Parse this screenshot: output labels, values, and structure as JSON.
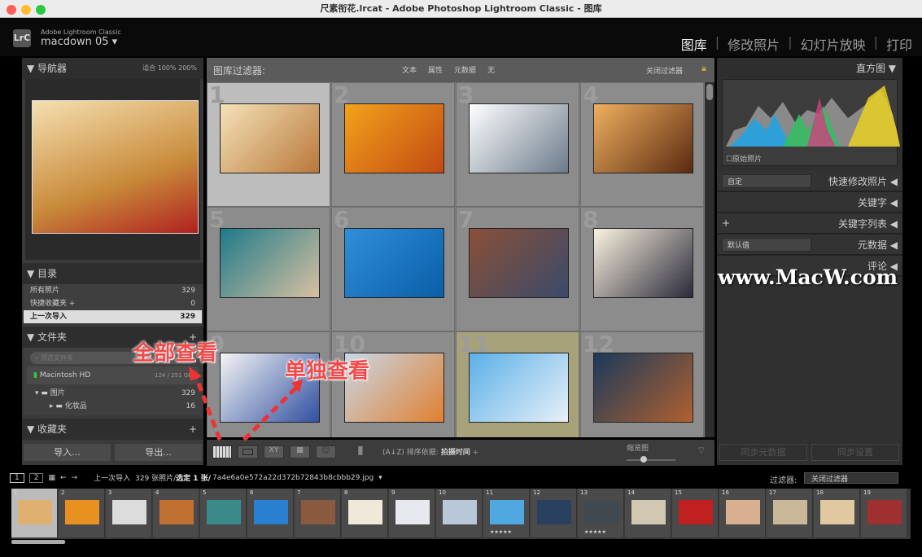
{
  "window": {
    "title": "尺素衔花.lrcat - Adobe Photoshop Lightroom Classic - 图库"
  },
  "identity": {
    "logo": "LrC",
    "app": "Adobe Lightroom Classic",
    "user": "macdown 05"
  },
  "modules": [
    "图库",
    "修改照片",
    "幻灯片放映",
    "打印"
  ],
  "navigator": {
    "title": "导航器",
    "zoom": [
      "适合",
      "100%",
      "200%"
    ],
    "preview_colors": [
      "#f5e0b0",
      "#c88a3a"
    ]
  },
  "catalog": {
    "title": "目录",
    "items": [
      {
        "label": "所有照片",
        "count": "329"
      },
      {
        "label": "快捷收藏夹 +",
        "count": "0"
      },
      {
        "label": "上一次导入",
        "count": "329"
      }
    ]
  },
  "folders": {
    "title": "文件夹",
    "search_placeholder": "筛选文件夹",
    "volume": "Macintosh HD",
    "volume_size": "124 / 251 GB",
    "items": [
      {
        "label": "图片",
        "count": "329"
      },
      {
        "label": "化妆品",
        "count": "16"
      }
    ]
  },
  "collections": {
    "title": "收藏夹"
  },
  "left_buttons": {
    "import": "导入...",
    "export": "导出..."
  },
  "filter_bar": {
    "title": "图库过滤器:",
    "options": [
      "文本",
      "属性",
      "元数据",
      "无"
    ],
    "preset": "关闭过滤器"
  },
  "grid": [
    {
      "n": "1",
      "colors": [
        "#f4e2b8",
        "#b9783a"
      ]
    },
    {
      "n": "2",
      "colors": [
        "#f3a21c",
        "#c24a12"
      ]
    },
    {
      "n": "3",
      "colors": [
        "#ffffff",
        "#6b7a8a"
      ]
    },
    {
      "n": "4",
      "colors": [
        "#f0b060",
        "#5a2a10"
      ]
    },
    {
      "n": "5",
      "colors": [
        "#1e7a8a",
        "#d8c0a0"
      ]
    },
    {
      "n": "6",
      "colors": [
        "#2f8fd8",
        "#0a5ea8"
      ]
    },
    {
      "n": "7",
      "colors": [
        "#8a5038",
        "#3a4a6a"
      ]
    },
    {
      "n": "8",
      "colors": [
        "#fbf3e0",
        "#2a2a3a"
      ]
    },
    {
      "n": "9",
      "colors": [
        "#f4f4f4",
        "#3050a0"
      ]
    },
    {
      "n": "10",
      "colors": [
        "#c8d8e8",
        "#e08030"
      ]
    },
    {
      "n": "11",
      "colors": [
        "#5ab0e8",
        "#e8f0f8"
      ],
      "stars": "★★★★★"
    },
    {
      "n": "12",
      "colors": [
        "#1a3a5a",
        "#b06030"
      ]
    }
  ],
  "toolbar": {
    "sort_label": "排序依据:",
    "sort_value": "拍摄时间",
    "thumb_label": "缩览图",
    "thumbnail_size": 0.35
  },
  "histogram": {
    "title": "直方图",
    "original": "原始照片"
  },
  "right_panels": [
    {
      "label": "快速修改照片",
      "select": "自定"
    },
    {
      "label": "关键字"
    },
    {
      "label": "关键字列表",
      "plus": "+"
    },
    {
      "label": "元数据",
      "select": "默认值"
    },
    {
      "label": "评论"
    }
  ],
  "sync": {
    "metadata": "同步元数据",
    "settings": "同步设置"
  },
  "filmstrip_bar": {
    "source": "上一次导入",
    "count": "329 张照片/",
    "selected": "选定 1 张/",
    "file": "7a4e6a0e572a22d372b72843b8cbbb29.jpg",
    "filter_label": "过滤器:",
    "filter_value": "关闭过滤器",
    "pages": [
      "1",
      "2"
    ]
  },
  "filmstrip": [
    {
      "n": "1",
      "c": "#e0b070"
    },
    {
      "n": "2",
      "c": "#e89020"
    },
    {
      "n": "3",
      "c": "#dcdcdc"
    },
    {
      "n": "4",
      "c": "#c07030"
    },
    {
      "n": "5",
      "c": "#3a8a8a"
    },
    {
      "n": "6",
      "c": "#2a80d0"
    },
    {
      "n": "7",
      "c": "#8a5a40"
    },
    {
      "n": "8",
      "c": "#f0e8d8"
    },
    {
      "n": "9",
      "c": "#e8e8f0"
    },
    {
      "n": "10",
      "c": "#b8c8d8"
    },
    {
      "n": "11",
      "c": "#50a8e0",
      "stars": "★★★★★"
    },
    {
      "n": "12",
      "c": "#2a4060"
    },
    {
      "n": "13",
      "c": "#404850",
      "stars": "★★★★★"
    },
    {
      "n": "14",
      "c": "#d0c8b0"
    },
    {
      "n": "15",
      "c": "#c02020"
    },
    {
      "n": "16",
      "c": "#d8b090"
    },
    {
      "n": "17",
      "c": "#c8b898"
    },
    {
      "n": "18",
      "c": "#e0c8a0"
    },
    {
      "n": "19",
      "c": "#a03030"
    }
  ],
  "annotations": {
    "all": "全部查看",
    "single": "单独查看",
    "watermark": "www.MacW.com"
  }
}
